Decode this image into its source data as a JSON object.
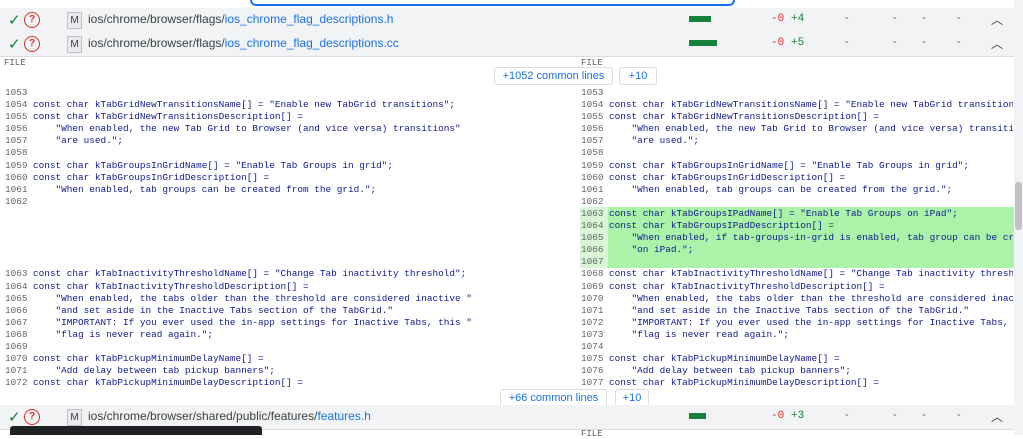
{
  "files": [
    {
      "path_prefix": "ios/chrome/browser/flags/",
      "file_name": "ios_chrome_flag_descriptions.h",
      "status": "M",
      "deleted": "-0",
      "added": "+4",
      "dashes": [
        "-",
        "-",
        "-",
        "-"
      ]
    },
    {
      "path_prefix": "ios/chrome/browser/flags/",
      "file_name": "ios_chrome_flag_descriptions.cc",
      "status": "M",
      "deleted": "-0",
      "added": "+5",
      "dashes": [
        "-",
        "-",
        "-",
        "-"
      ]
    },
    {
      "path_prefix": "ios/chrome/browser/shared/public/features/",
      "file_name": "features.h",
      "status": "M",
      "deleted": "-0",
      "added": "+3",
      "dashes": [
        "-",
        "-",
        "-",
        "-"
      ]
    }
  ],
  "diff": {
    "file_label_left": "FILE",
    "file_label_right": "FILE",
    "common_top": "+1052 common lines",
    "expand_top": "+10",
    "common_bottom": "+66 common lines",
    "expand_bottom": "+10",
    "left_lines": [
      {
        "n": "1053",
        "t": ""
      },
      {
        "n": "1054",
        "t": "const char kTabGridNewTransitionsName[] = \"Enable new TabGrid transitions\";"
      },
      {
        "n": "1055",
        "t": "const char kTabGridNewTransitionsDescription[] ="
      },
      {
        "n": "1056",
        "t": "    \"When enabled, the new Tab Grid to Browser (and vice versa) transitions\""
      },
      {
        "n": "1057",
        "t": "    \"are used.\";"
      },
      {
        "n": "1058",
        "t": ""
      },
      {
        "n": "1059",
        "t": "const char kTabGroupsInGridName[] = \"Enable Tab Groups in grid\";"
      },
      {
        "n": "1060",
        "t": "const char kTabGroupsInGridDescription[] ="
      },
      {
        "n": "1061",
        "t": "    \"When enabled, tab groups can be created from the grid.\";"
      },
      {
        "n": "1062",
        "t": ""
      },
      {
        "n": "",
        "t": ""
      },
      {
        "n": "",
        "t": ""
      },
      {
        "n": "",
        "t": ""
      },
      {
        "n": "",
        "t": ""
      },
      {
        "n": "",
        "t": ""
      },
      {
        "n": "1063",
        "t": "const char kTabInactivityThresholdName[] = \"Change Tab inactivity threshold\";"
      },
      {
        "n": "1064",
        "t": "const char kTabInactivityThresholdDescription[] ="
      },
      {
        "n": "1065",
        "t": "    \"When enabled, the tabs older than the threshold are considered inactive \""
      },
      {
        "n": "1066",
        "t": "    \"and set aside in the Inactive Tabs section of the TabGrid.\""
      },
      {
        "n": "1067",
        "t": "    \"IMPORTANT: If you ever used the in-app settings for Inactive Tabs, this \""
      },
      {
        "n": "1068",
        "t": "    \"flag is never read again.\";"
      },
      {
        "n": "1069",
        "t": ""
      },
      {
        "n": "1070",
        "t": "const char kTabPickupMinimumDelayName[] ="
      },
      {
        "n": "1071",
        "t": "    \"Add delay between tab pickup banners\";"
      },
      {
        "n": "1072",
        "t": "const char kTabPickupMinimumDelayDescription[] ="
      }
    ],
    "right_lines": [
      {
        "n": "1053",
        "t": ""
      },
      {
        "n": "1054",
        "t": "const char kTabGridNewTransitionsName[] = \"Enable new TabGrid transitions\";"
      },
      {
        "n": "1055",
        "t": "const char kTabGridNewTransitionsDescription[] ="
      },
      {
        "n": "1056",
        "t": "    \"When enabled, the new Tab Grid to Browser (and vice versa) transitions"
      },
      {
        "n": "1057",
        "t": "    \"are used.\";"
      },
      {
        "n": "1058",
        "t": ""
      },
      {
        "n": "1059",
        "t": "const char kTabGroupsInGridName[] = \"Enable Tab Groups in grid\";"
      },
      {
        "n": "1060",
        "t": "const char kTabGroupsInGridDescription[] ="
      },
      {
        "n": "1061",
        "t": "    \"When enabled, tab groups can be created from the grid.\";"
      },
      {
        "n": "1062",
        "t": ""
      },
      {
        "n": "1063",
        "t": "const char kTabGroupsIPadName[] = \"Enable Tab Groups on iPad\";"
      },
      {
        "n": "1064",
        "t": "const char kTabGroupsIPadDescription[] ="
      },
      {
        "n": "1065",
        "t": "    \"When enabled, if tab-groups-in-grid is enabled, tab group can be creat"
      },
      {
        "n": "1066",
        "t": "    \"on iPad.\";"
      },
      {
        "n": "1067",
        "t": ""
      },
      {
        "n": "1068",
        "t": "const char kTabInactivityThresholdName[] = \"Change Tab inactivity threshold"
      },
      {
        "n": "1069",
        "t": "const char kTabInactivityThresholdDescription[] ="
      },
      {
        "n": "1070",
        "t": "    \"When enabled, the tabs older than the threshold are considered inactiv"
      },
      {
        "n": "1071",
        "t": "    \"and set aside in the Inactive Tabs section of the TabGrid.\""
      },
      {
        "n": "1072",
        "t": "    \"IMPORTANT: If you ever used the in-app settings for Inactive Tabs, thi"
      },
      {
        "n": "1073",
        "t": "    \"flag is never read again.\";"
      },
      {
        "n": "1074",
        "t": ""
      },
      {
        "n": "1075",
        "t": "const char kTabPickupMinimumDelayName[] ="
      },
      {
        "n": "1076",
        "t": "    \"Add delay between tab pickup banners\";"
      },
      {
        "n": "1077",
        "t": "const char kTabPickupMinimumDelayDescription[] ="
      }
    ]
  },
  "colors": {
    "added_bg": "#aaf3a8",
    "added_num_bg": "#d9f7d6",
    "code_text": "#101a8c",
    "link": "#1a73e8"
  }
}
